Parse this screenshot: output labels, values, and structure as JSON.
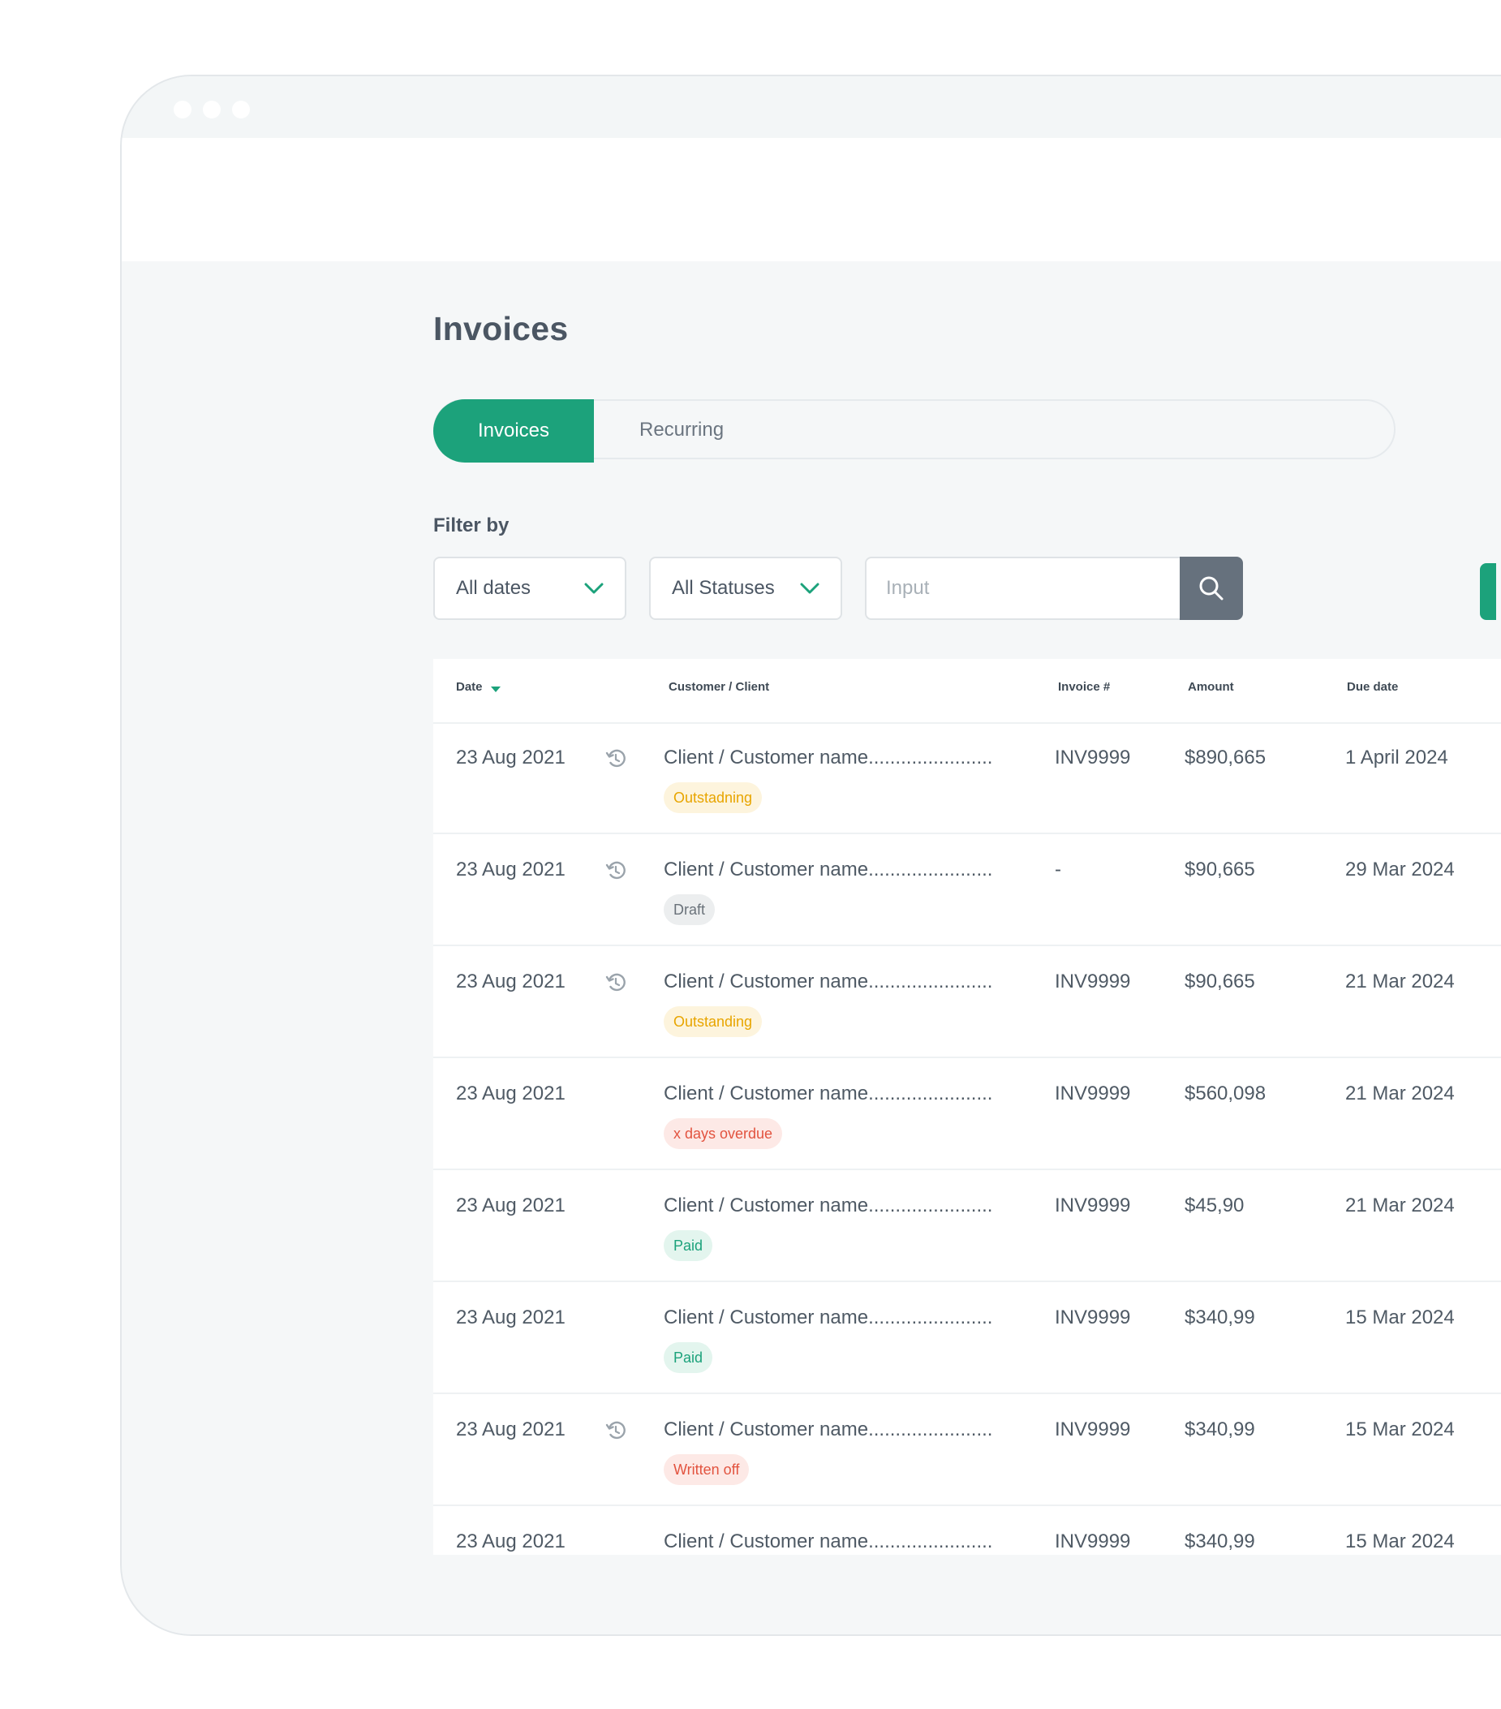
{
  "colors": {
    "accent": "#1ca27b",
    "badge_outstanding_bg": "#fdf4dd",
    "badge_outstanding_fg": "#e8a500",
    "badge_draft_bg": "#eceeef",
    "badge_draft_fg": "#6a727a",
    "badge_overdue_bg": "#fde9e6",
    "badge_overdue_fg": "#e2533f",
    "badge_paid_bg": "#e3f5ee",
    "badge_paid_fg": "#1ca27b"
  },
  "page": {
    "title": "Invoices"
  },
  "tabs": [
    {
      "label": "Invoices",
      "active": true
    },
    {
      "label": "Recurring",
      "active": false
    }
  ],
  "filter": {
    "label": "Filter by",
    "dates": {
      "value": "All dates",
      "icon": "chevron-down-icon"
    },
    "statuses": {
      "value": "All Statuses",
      "icon": "chevron-down-icon"
    },
    "search": {
      "placeholder": "Input",
      "icon": "search-icon"
    }
  },
  "table": {
    "columns": [
      "Date",
      "Customer / Client",
      "Invoice #",
      "Amount",
      "Due date"
    ],
    "rows": [
      {
        "date": "23 Aug 2021",
        "history_icon": true,
        "client": "Client / Customer name.......................",
        "status": "Outstadning",
        "status_type": "outstanding",
        "invoice": "INV9999",
        "amount": "$890,665",
        "due": "1 April 2024"
      },
      {
        "date": "23 Aug 2021",
        "history_icon": true,
        "client": "Client / Customer name.......................",
        "status": "Draft",
        "status_type": "draft",
        "invoice": "-",
        "amount": "$90,665",
        "due": "29 Mar 2024"
      },
      {
        "date": "23 Aug 2021",
        "history_icon": true,
        "client": "Client / Customer name.......................",
        "status": "Outstanding",
        "status_type": "outstanding",
        "invoice": "INV9999",
        "amount": "$90,665",
        "due": "21 Mar 2024"
      },
      {
        "date": "23 Aug 2021",
        "history_icon": false,
        "client": "Client / Customer name.......................",
        "status": "x days overdue",
        "status_type": "overdue",
        "invoice": "INV9999",
        "amount": "$560,098",
        "due": "21 Mar 2024"
      },
      {
        "date": "23 Aug 2021",
        "history_icon": false,
        "client": "Client / Customer name.......................",
        "status": "Paid",
        "status_type": "paid",
        "invoice": "INV9999",
        "amount": "$45,90",
        "due": "21 Mar 2024"
      },
      {
        "date": "23 Aug 2021",
        "history_icon": false,
        "client": "Client / Customer name.......................",
        "status": "Paid",
        "status_type": "paid",
        "invoice": "INV9999",
        "amount": "$340,99",
        "due": "15 Mar 2024"
      },
      {
        "date": "23 Aug 2021",
        "history_icon": true,
        "client": "Client / Customer name.......................",
        "status": "Written off",
        "status_type": "overdue",
        "invoice": "INV9999",
        "amount": "$340,99",
        "due": "15 Mar 2024"
      },
      {
        "date": "23 Aug 2021",
        "history_icon": false,
        "client": "Client / Customer name.......................",
        "status": "",
        "status_type": "none",
        "invoice": "INV9999",
        "amount": "$340,99",
        "due": "15 Mar 2024"
      }
    ]
  }
}
